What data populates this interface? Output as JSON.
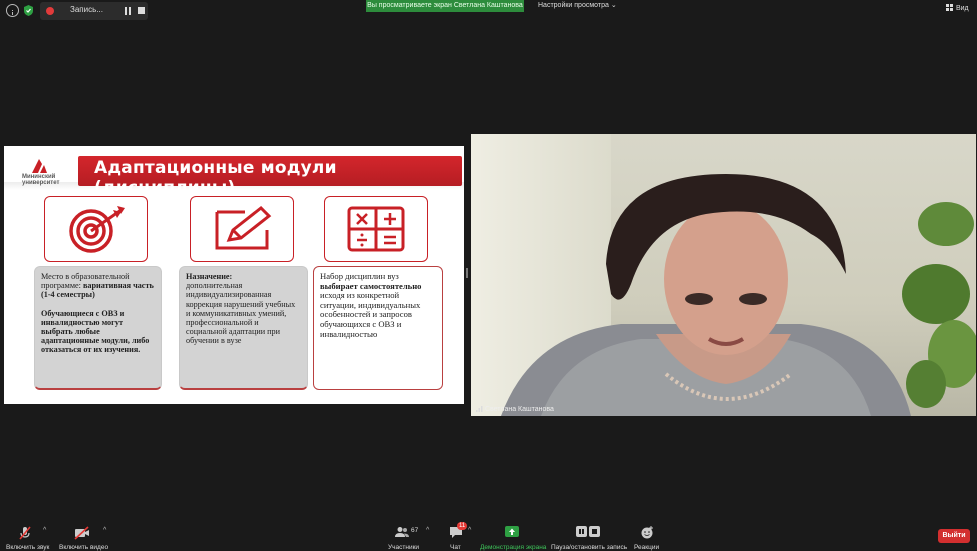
{
  "topbar": {
    "recording_label": "Запись...",
    "share_banner": "Вы просматриваете экран Светлана Каштанова",
    "view_settings": "Настройки просмотра",
    "view_settings_caret": "⌄",
    "view_label": "Вид"
  },
  "slide": {
    "logo_line1": "Мининский",
    "logo_line2": "университет",
    "title": "Адаптационные модули (дисциплины)",
    "icons": [
      "target-icon",
      "pencil-icon",
      "calculator-icon"
    ],
    "card1": {
      "text1": "Место в образовательной программе: ",
      "bold1": "вариативная часть (1-4 семестры)",
      "bold2": "Обучающиеся с ОВЗ и инвалидностью могут выбрать любые адаптационные модули, либо отказаться от их изучения."
    },
    "card2": {
      "bold1": "Назначение:",
      "text1": "дополнительная индивидуализированная коррекция нарушений учебных и коммуникативных умений, профессиональной и социальной адаптации при обучении в вузе"
    },
    "card3": {
      "text1": "Набор дисциплин вуз ",
      "bold1": "выбирает самостоятельно",
      "text2": " исходя из конкретной ситуации, индивидуальных особенностей и запросов обучающихся с ОВЗ и инвалидностью"
    }
  },
  "video": {
    "participant_name": "Светлана Каштанова"
  },
  "bottombar": {
    "mute_label": "Включить звук",
    "video_label": "Включить видео",
    "participants_label": "Участники",
    "participants_count": "67",
    "chat_label": "Чат",
    "chat_badge": "11",
    "share_label": "Демонстрация экрана",
    "record_label": "Пауза/остановить запись",
    "reactions_label": "Реакции",
    "exit_label": "Выйти",
    "caret": "^"
  },
  "colors": {
    "accent_red": "#c82026",
    "share_green": "#2d8c3c",
    "exit_red": "#d32f2f"
  }
}
